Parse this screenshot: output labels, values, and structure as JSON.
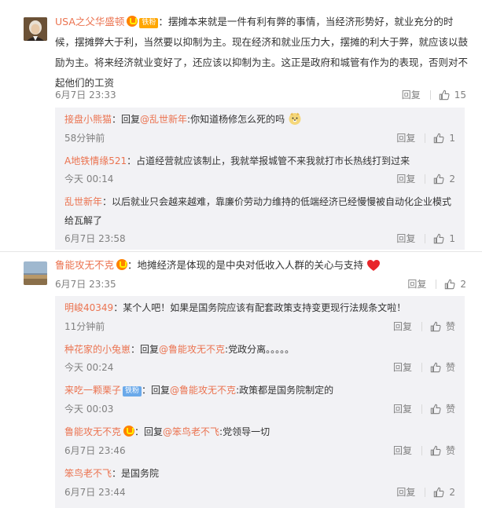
{
  "colors": {
    "accent": "#eb7350",
    "meta": "#808080",
    "reply_bg": "#f2f2f5"
  },
  "reply_label": "回复",
  "comments": [
    {
      "user": "USA之父华盛顿",
      "badge": "铁粉",
      "text": "：摆摊本来就是一件有利有弊的事情，当经济形势好，就业充分的时候，摆摊弊大于利，当然要以抑制为主。现在经济和就业压力大，摆摊的利大于弊，就应该以鼓励为主。将来经济就业变好了，还应该以抑制为主。这正是政府和城管有作为的表现，否则对不起他们的工资",
      "time": "6月7日 23:33",
      "likes": "15",
      "replies": [
        {
          "user": "接盘小熊猫",
          "prefix": "：回复",
          "at": "@乱世新年",
          "text": ":你知道杨修怎么死的吗",
          "time": "58分钟前",
          "likes": "1"
        },
        {
          "user": "A地铁情缘521",
          "prefix": "",
          "at": "",
          "text": "：占道经营就应该制止，我就举报城管不来我就打市长热线打到过来",
          "time": "今天 00:14",
          "likes": "2"
        },
        {
          "user": "乱世新年",
          "prefix": "",
          "at": "",
          "text": "：以后就业只会越来越难，靠廉价劳动力维持的低端经济已经慢慢被自动化企业模式给瓦解了",
          "time": "6月7日 23:58",
          "likes": "1"
        }
      ]
    },
    {
      "user": "鲁能攻无不克",
      "text": "：地摊经济是体现的是中央对低收入人群的关心与支持",
      "time": "6月7日 23:35",
      "likes": "2",
      "replies": [
        {
          "user": "明峻40349",
          "prefix": "",
          "at": "",
          "text": "：某个人吧！如果是国务院应该有配套政策支持变更现行法规条文啦！",
          "time": "11分钟前",
          "likes": "赞"
        },
        {
          "user": "种花家的小兔崽",
          "prefix": "：回复",
          "at": "@鲁能攻无不克",
          "text": ":党政分离。。。。。",
          "time": "今天 00:24",
          "likes": "赞"
        },
        {
          "user": "来吃一颗栗子",
          "badge": "铁粉",
          "prefix": "：回复",
          "at": "@鲁能攻无不克",
          "text": ":政策都是国务院制定的",
          "time": "今天 00:03",
          "likes": "赞"
        },
        {
          "user": "鲁能攻无不克",
          "prefix": "：回复",
          "at": "@笨鸟老不飞",
          "text": ":党领导一切",
          "time": "6月7日 23:46",
          "likes": "赞"
        },
        {
          "user": "笨鸟老不飞",
          "prefix": "",
          "at": "",
          "text": "：是国务院",
          "time": "6月7日 23:44",
          "likes": "2"
        }
      ]
    }
  ]
}
